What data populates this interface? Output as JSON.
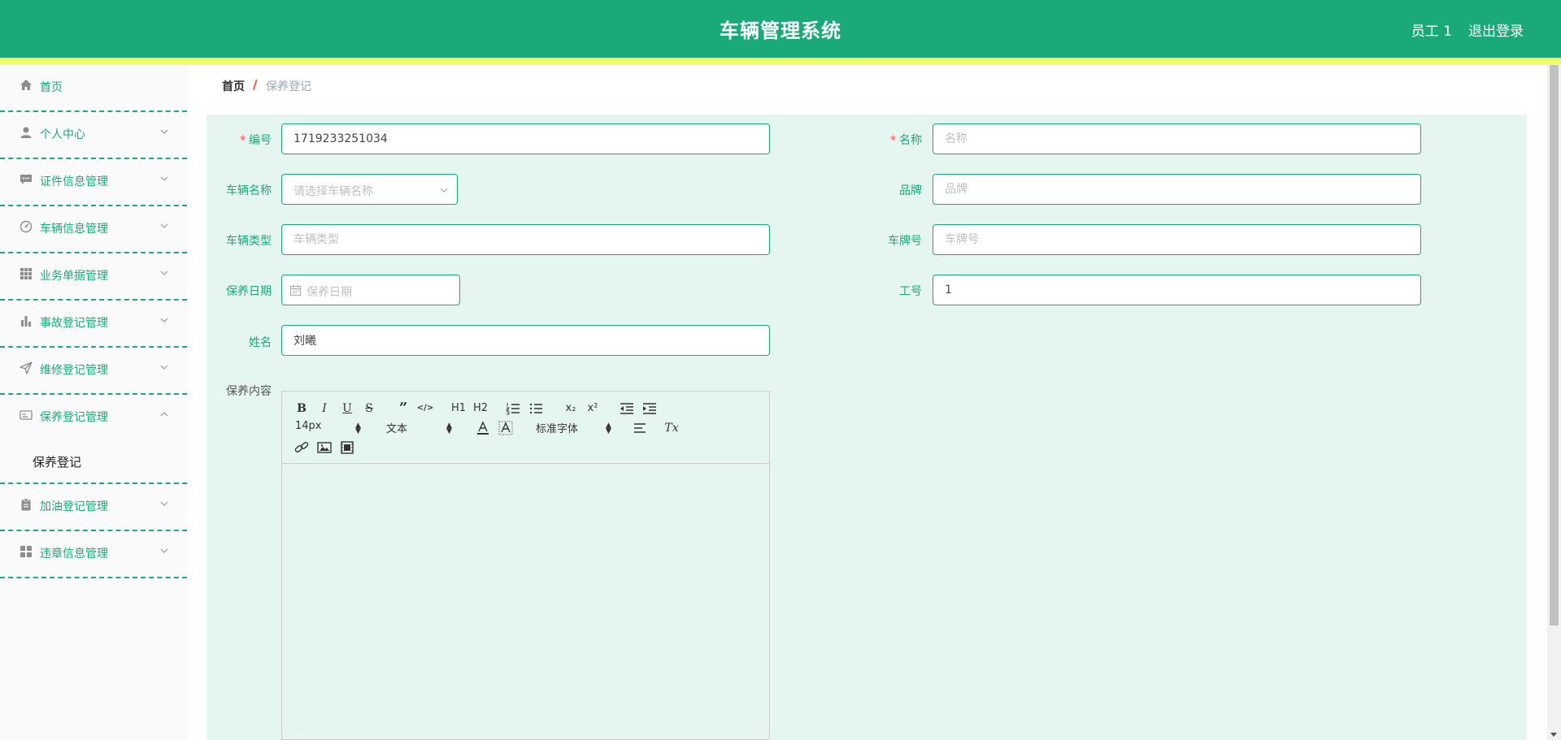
{
  "header": {
    "title": "车辆管理系统",
    "user": "员工 1",
    "logout": "退出登录"
  },
  "sidebar": {
    "home": "首页",
    "items": [
      {
        "label": "个人中心",
        "icon": "user-icon"
      },
      {
        "label": "证件信息管理",
        "icon": "message-icon"
      },
      {
        "label": "车辆信息管理",
        "icon": "dashboard-icon"
      },
      {
        "label": "业务单据管理",
        "icon": "grid-icon"
      },
      {
        "label": "事故登记管理",
        "icon": "bar-chart-icon"
      },
      {
        "label": "维修登记管理",
        "icon": "send-icon"
      },
      {
        "label": "保养登记管理",
        "icon": "card-icon",
        "expanded": true,
        "sub": [
          "保养登记"
        ]
      },
      {
        "label": "加油登记管理",
        "icon": "clipboard-icon"
      },
      {
        "label": "违章信息管理",
        "icon": "apps-icon"
      }
    ]
  },
  "breadcrumb": {
    "home": "首页",
    "sep": "/",
    "current": "保养登记"
  },
  "form": {
    "bianhao": {
      "label": "编号",
      "value": "1719233251034"
    },
    "mingcheng": {
      "label": "名称",
      "placeholder": "名称"
    },
    "cheliangmingcheng": {
      "label": "车辆名称",
      "placeholder": "请选择车辆名称"
    },
    "pinpai": {
      "label": "品牌",
      "placeholder": "品牌"
    },
    "cheliangleixing": {
      "label": "车辆类型",
      "placeholder": "车辆类型"
    },
    "chepaihao": {
      "label": "车牌号",
      "placeholder": "车牌号"
    },
    "baoyangriqi": {
      "label": "保养日期",
      "placeholder": "保养日期"
    },
    "gonghao": {
      "label": "工号",
      "value": "1"
    },
    "xingming": {
      "label": "姓名",
      "value": "刘曦"
    },
    "baoyangneirong": {
      "label": "保养内容"
    }
  },
  "editor": {
    "size": "14px",
    "header": "文本",
    "font": "标准字体",
    "buttons": {
      "bold": "B",
      "italic": "I",
      "underline": "U",
      "strike": "S",
      "quote": "”",
      "code": "</>",
      "h1": "H1",
      "h2": "H2",
      "sub": "x₂",
      "sup": "x²",
      "clean": "Tx"
    }
  },
  "colors": {
    "primary": "#1aaa7a",
    "accent_bar": "#f2ff6c",
    "panel": "#e4f6ef",
    "required": "#ff4d4f"
  }
}
